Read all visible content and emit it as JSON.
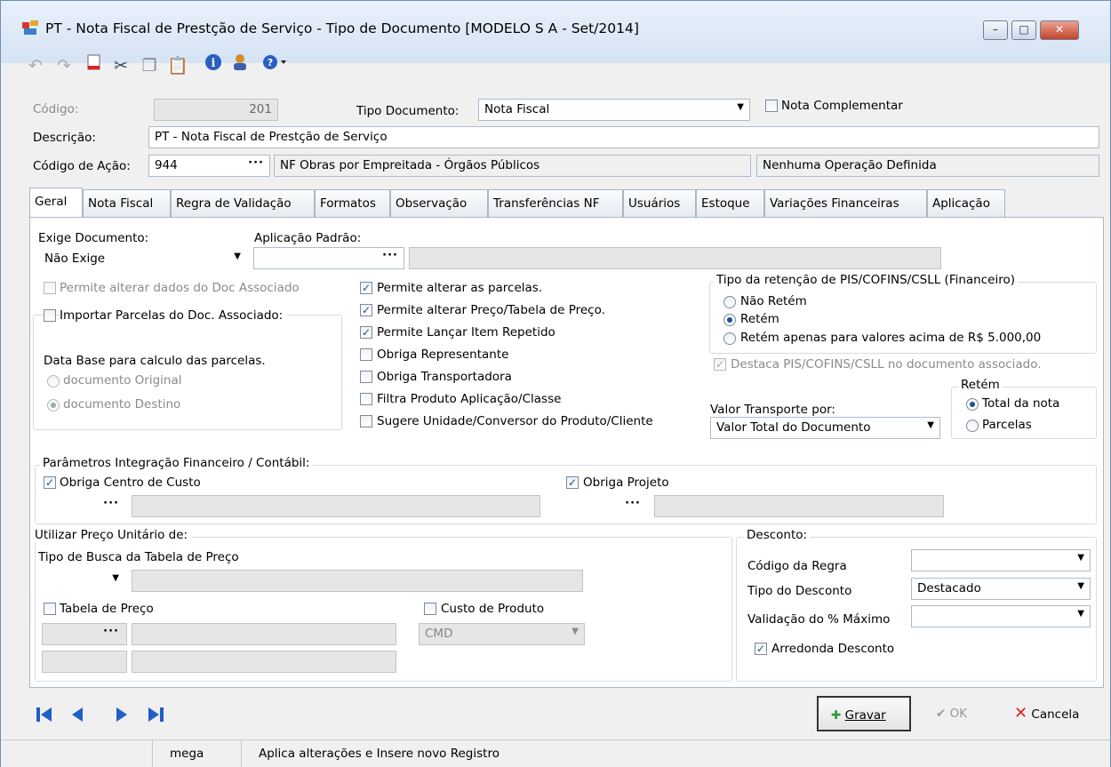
{
  "window": {
    "title": "PT - Nota Fiscal de Prestção de Serviço -  Tipo de Documento [MODELO S A - Set/2014]",
    "minimize": "–",
    "maximize": "□",
    "close": "✕"
  },
  "toolbar": {
    "icons": [
      "undo-icon",
      "redo-icon",
      "new-doc-icon",
      "cut-icon",
      "copy-icon",
      "paste-icon",
      "info-icon",
      "user-icon",
      "help-icon"
    ]
  },
  "header": {
    "codigo_label": "Código:",
    "codigo_value": "201",
    "tipo_doc_label": "Tipo Documento:",
    "tipo_doc_value": "Nota Fiscal",
    "nota_complementar": "Nota Complementar",
    "descricao_label": "Descrição:",
    "descricao_value": "PT - Nota Fiscal de Prestção de Serviço",
    "codigo_acao_label": "Código de Ação:",
    "codigo_acao_value": "944",
    "codigo_acao_desc": "NF Obras por Empreitada - Órgãos Públicos",
    "operacao": "Nenhuma Operação Definida"
  },
  "tabs": [
    "Geral",
    "Nota Fiscal",
    "Regra de Validação",
    "Formatos",
    "Observação",
    "Transferências NF",
    "Usuários",
    "Estoque",
    "Variações Financeiras",
    "Aplicação"
  ],
  "geral": {
    "exige_doc_label": "Exige Documento:",
    "exige_doc_value": "Não Exige",
    "aplicacao_label": "Aplicação Padrão:",
    "permite_alterar_doc": "Permite alterar dados do Doc Associado",
    "importar_parcelas": "Importar Parcelas do Doc. Associado:",
    "data_base_label": "Data Base para calculo das parcelas.",
    "doc_original": "documento Original",
    "doc_destino": "documento Destino",
    "checks": [
      {
        "label": "Permite alterar as parcelas.",
        "checked": true
      },
      {
        "label": "Permite alterar Preço/Tabela de Preço.",
        "checked": true
      },
      {
        "label": "Permite Lançar Item Repetido",
        "checked": true
      },
      {
        "label": "Obriga Representante",
        "checked": false
      },
      {
        "label": "Obriga Transportadora",
        "checked": false
      },
      {
        "label": "Filtra Produto Aplicação/Classe",
        "checked": false
      },
      {
        "label": "Sugere Unidade/Conversor do Produto/Cliente",
        "checked": false
      }
    ],
    "retencao_title": "Tipo da retenção de PIS/COFINS/CSLL (Financeiro)",
    "retencao_opts": [
      "Não Retém",
      "Retém",
      "Retém apenas para valores acima de R$ 5.000,00"
    ],
    "destaca": "Destaca PIS/COFINS/CSLL no documento associado.",
    "valor_transp_label": "Valor Transporte por:",
    "valor_transp_value": "Valor Total do Documento",
    "retem_title": "Retém",
    "retem_opts": [
      "Total da nota",
      "Parcelas"
    ],
    "param_title": "Parâmetros Integração Financeiro / Contábil:",
    "obriga_cc": "Obriga Centro de Custo",
    "obriga_proj": "Obriga Projeto",
    "preco_title": "Utilizar Preço Unitário de:",
    "tipo_busca": "Tipo de Busca da Tabela de Preço",
    "tabela_preco": "Tabela de Preço",
    "custo_produto": "Custo de Produto",
    "cmd": "CMD",
    "desconto_title": "Desconto:",
    "cod_regra": "Código da Regra",
    "tipo_desc": "Tipo do Desconto",
    "tipo_desc_value": "Destacado",
    "validacao": "Validação do % Máximo",
    "arredonda": "Arredonda Desconto"
  },
  "bottom": {
    "gravar": "Gravar",
    "ok": "OK",
    "cancela": "Cancela"
  },
  "status": {
    "user": "mega",
    "message": "Aplica alterações e Insere novo Registro"
  }
}
